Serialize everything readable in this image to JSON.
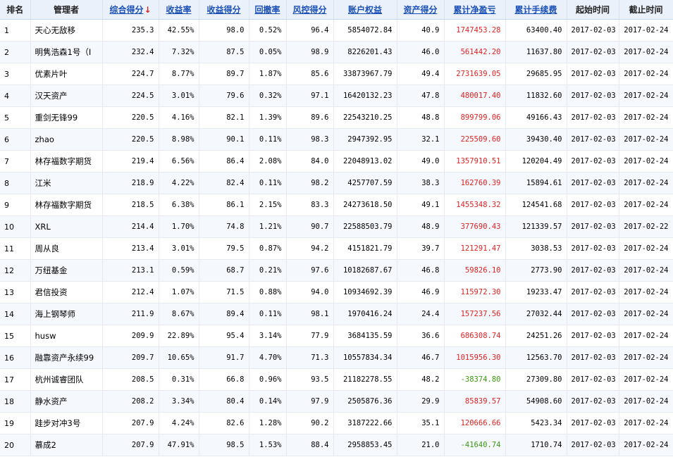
{
  "headers": [
    {
      "label": "排名",
      "sortable": false
    },
    {
      "label": "管理者",
      "sortable": false
    },
    {
      "label": "综合得分",
      "sortable": true,
      "sorted": "desc"
    },
    {
      "label": "收益率",
      "sortable": true
    },
    {
      "label": "收益得分",
      "sortable": true
    },
    {
      "label": "回撤率",
      "sortable": true
    },
    {
      "label": "风控得分",
      "sortable": true
    },
    {
      "label": "账户权益",
      "sortable": true
    },
    {
      "label": "资产得分",
      "sortable": true
    },
    {
      "label": "累计净盈亏",
      "sortable": true
    },
    {
      "label": "累计手续费",
      "sortable": true
    },
    {
      "label": "起始时间",
      "sortable": false
    },
    {
      "label": "截止时间",
      "sortable": false
    }
  ],
  "sort_arrow": "↓",
  "colors": {
    "header_bg": "#eaf1fb",
    "link": "#1a4fb5",
    "positive": "#e02020",
    "negative": "#3a9a10"
  },
  "rows": [
    [
      "1",
      "天心无敌移",
      "235.3",
      "42.55%",
      "98.0",
      "0.52%",
      "96.4",
      "5854072.84",
      "40.9",
      "1747453.28",
      "63400.40",
      "2017-02-03",
      "2017-02-24"
    ],
    [
      "2",
      "明隽浩森1号（I",
      "232.4",
      "7.32%",
      "87.5",
      "0.05%",
      "98.9",
      "8226201.43",
      "46.0",
      "561442.20",
      "11637.80",
      "2017-02-03",
      "2017-02-24"
    ],
    [
      "3",
      "优素片叶",
      "224.7",
      "8.77%",
      "89.7",
      "1.87%",
      "85.6",
      "33873967.79",
      "49.4",
      "2731639.05",
      "29685.95",
      "2017-02-03",
      "2017-02-24"
    ],
    [
      "4",
      "汉天资产",
      "224.5",
      "3.01%",
      "79.6",
      "0.32%",
      "97.1",
      "16420132.23",
      "47.8",
      "480017.40",
      "11832.60",
      "2017-02-03",
      "2017-02-24"
    ],
    [
      "5",
      "重剑无锋99",
      "220.5",
      "4.16%",
      "82.1",
      "1.39%",
      "89.6",
      "22543210.25",
      "48.8",
      "899799.06",
      "49166.43",
      "2017-02-03",
      "2017-02-24"
    ],
    [
      "6",
      "zhao",
      "220.5",
      "8.98%",
      "90.1",
      "0.11%",
      "98.3",
      "2947392.95",
      "32.1",
      "225509.60",
      "39430.40",
      "2017-02-03",
      "2017-02-24"
    ],
    [
      "7",
      "林存福数字期货",
      "219.4",
      "6.56%",
      "86.4",
      "2.08%",
      "84.0",
      "22048913.02",
      "49.0",
      "1357910.51",
      "120204.49",
      "2017-02-03",
      "2017-02-24"
    ],
    [
      "8",
      "江米",
      "218.9",
      "4.22%",
      "82.4",
      "0.11%",
      "98.2",
      "4257707.59",
      "38.3",
      "162760.39",
      "15894.61",
      "2017-02-03",
      "2017-02-24"
    ],
    [
      "9",
      "林存福数字期货",
      "218.5",
      "6.38%",
      "86.1",
      "2.15%",
      "83.3",
      "24273618.50",
      "49.1",
      "1455348.32",
      "124541.68",
      "2017-02-03",
      "2017-02-24"
    ],
    [
      "10",
      "XRL",
      "214.4",
      "1.70%",
      "74.8",
      "1.21%",
      "90.7",
      "22588503.79",
      "48.9",
      "377690.43",
      "121339.57",
      "2017-02-03",
      "2017-02-22"
    ],
    [
      "11",
      "周从良",
      "213.4",
      "3.01%",
      "79.5",
      "0.87%",
      "94.2",
      "4151821.79",
      "39.7",
      "121291.47",
      "3038.53",
      "2017-02-03",
      "2017-02-24"
    ],
    [
      "12",
      "万纽基金",
      "213.1",
      "0.59%",
      "68.7",
      "0.21%",
      "97.6",
      "10182687.67",
      "46.8",
      "59826.10",
      "2773.90",
      "2017-02-03",
      "2017-02-24"
    ],
    [
      "13",
      "君信投资",
      "212.4",
      "1.07%",
      "71.5",
      "0.88%",
      "94.0",
      "10934692.39",
      "46.9",
      "115972.30",
      "19233.47",
      "2017-02-03",
      "2017-02-24"
    ],
    [
      "14",
      "海上钢琴师",
      "211.9",
      "8.67%",
      "89.4",
      "0.11%",
      "98.1",
      "1970416.24",
      "24.4",
      "157237.56",
      "27032.44",
      "2017-02-03",
      "2017-02-24"
    ],
    [
      "15",
      "husw",
      "209.9",
      "22.89%",
      "95.4",
      "3.14%",
      "77.9",
      "3684135.59",
      "36.6",
      "686308.74",
      "24251.26",
      "2017-02-03",
      "2017-02-24"
    ],
    [
      "16",
      "融靠资产永续99",
      "209.7",
      "10.65%",
      "91.7",
      "4.70%",
      "71.3",
      "10557834.34",
      "46.7",
      "1015956.30",
      "12563.70",
      "2017-02-03",
      "2017-02-24"
    ],
    [
      "17",
      "杭州诚睿团队",
      "208.5",
      "0.31%",
      "66.8",
      "0.96%",
      "93.5",
      "21182278.55",
      "48.2",
      "-38374.80",
      "27309.80",
      "2017-02-03",
      "2017-02-24"
    ],
    [
      "18",
      "静水资产",
      "208.2",
      "3.34%",
      "80.4",
      "0.14%",
      "97.9",
      "2505876.36",
      "29.9",
      "85839.57",
      "54908.60",
      "2017-02-03",
      "2017-02-24"
    ],
    [
      "19",
      "跬步对冲3号",
      "207.9",
      "4.24%",
      "82.6",
      "1.28%",
      "90.2",
      "3187222.66",
      "35.1",
      "120666.66",
      "5423.34",
      "2017-02-03",
      "2017-02-24"
    ],
    [
      "20",
      "慕成2",
      "207.9",
      "47.91%",
      "98.5",
      "1.53%",
      "88.4",
      "2958853.45",
      "21.0",
      "-41640.74",
      "1710.74",
      "2017-02-03",
      "2017-02-24"
    ]
  ]
}
